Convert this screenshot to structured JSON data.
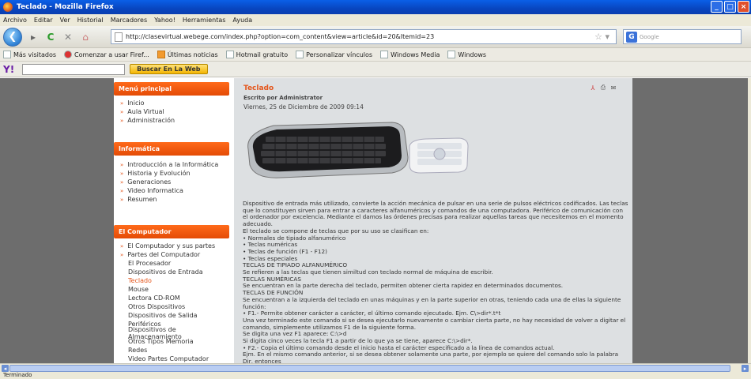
{
  "window": {
    "title": "Teclado - Mozilla Firefox"
  },
  "menubar": [
    "Archivo",
    "Editar",
    "Ver",
    "Historial",
    "Marcadores",
    "Yahoo!",
    "Herramientas",
    "Ayuda"
  ],
  "navbar": {
    "url": "http://clasevirtual.webege.com/index.php?option=com_content&view=article&id=20&Itemid=23",
    "search_placeholder": "Google"
  },
  "bookmarks": [
    "Más visitados",
    "Comenzar a usar Firef...",
    "Últimas noticias",
    "Hotmail gratuito",
    "Personalizar vínculos",
    "Windows Media",
    "Windows"
  ],
  "toolbar": {
    "search_button": "Buscar En La Web"
  },
  "sidebar": {
    "menu_principal": {
      "title": "Menú principal",
      "items": [
        "Inicio",
        "Aula Virtual",
        "Administración"
      ]
    },
    "informatica": {
      "title": "Informática",
      "items": [
        "Introducción a la Informática",
        "Historia y Evolución",
        "Generaciones",
        "Video Informatica",
        "Resumen"
      ]
    },
    "computador": {
      "title": "El Computador",
      "items": [
        "El Computador y sus partes",
        "Partes del Computador"
      ],
      "subitems": [
        "El Procesador",
        "Dispositivos de Entrada",
        "Teclado",
        "Mouse",
        "Lectora CD-ROM",
        "Otros Dispositivos",
        "Dispositivos de Salida",
        "Periféricos",
        "Dispositivos de Almacenamiento",
        "Otros Tipos Memoria",
        "Redes",
        "Video Partes Computador"
      ]
    }
  },
  "article": {
    "title": "Teclado",
    "author": "Escrito por Administrator",
    "date": "Viernes, 25 de Diciembre de 2009 09:14",
    "paragraphs": [
      "Dispositivo de entrada más utilizado, convierte la acción mecánica de pulsar en una serie de pulsos eléctricos codificados. Las teclas que lo constituyen sirven para entrar a caracteres alfanuméricos y comandos de una computadora. Periférico de comunicación con el ordenador por excelencia. Mediante el damos las órdenes precisas para realizar aquellas tareas que necesitemos en el momento adecuado.",
      "El teclado se compone de teclas que por su uso se clasifican en:",
      "• Normales de tipiado  alfanumérico",
      "• Teclas numéricas",
      "• Teclas de función (F1 - F12)",
      "• Teclas especiales",
      "TECLAS DE TIPIADO ALFANUMÉRICO",
      "Se refieren a las teclas que tienen  similtud con teclado normal de máquina de escribir.",
      "TECLAS NUMÉRICAS",
      "Se encuentran en la parte  derecha del teclado, permiten obtener cierta rapidez en determinados documentos.",
      "TECLAS DE FUNCIÓN",
      "Se encuentran a la izquierda del teclado en unas máquinas y en la parte superior en otras, teniendo cada una de ellas la siguiente función:",
      "• F1.- Permite obtener carácter  a carácter, el último comando ejecutado.  Ejm. C\\>dir*.t*t",
      "Una vez terminado este comando si se desea ejecutarlo nuevamente o cambiar cierta parte, no hay necesidad de volver a digitar el comando, simplemente utilizamos  F1 de la siguiente forma.",
      "Se digita una vez F1 aparece: C:\\>d",
      "Si digita cinco veces la tecla F1 a partir de lo que ya se tiene, aparece  C:\\>dir*.",
      "• F2.-  Copia el último comando  desde el inicio hasta el carácter especificado a la línea de comandos actual.",
      "Ejm. En el mismo comando anterior, si se desea obtener solamente una parte, por ejemplo  se quiere del comando solo la palabra Dir, entonces"
    ]
  },
  "status": "Terminado"
}
